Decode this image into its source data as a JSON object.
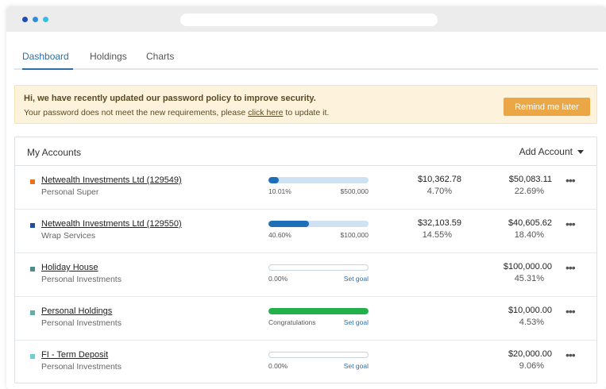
{
  "window": {
    "dot_colors": [
      "#1a4fb5",
      "#2f8ddb",
      "#33bfe0"
    ]
  },
  "tabs": [
    {
      "label": "Dashboard",
      "active": true
    },
    {
      "label": "Holdings",
      "active": false
    },
    {
      "label": "Charts",
      "active": false
    }
  ],
  "alert": {
    "title": "Hi, we have recently updated our password policy to improve security.",
    "message_before": "Your password does not meet the new requirements, please ",
    "link_text": "click here",
    "message_after": " to update it.",
    "button_label": "Remind me later"
  },
  "accounts": {
    "title": "My Accounts",
    "add_label": "Add Account",
    "rows": [
      {
        "name": "Netwealth Investments Ltd (129549)",
        "sub": "Personal Super",
        "swatch": "#e8731c",
        "progress": 0.1001,
        "bar_color": "#1f6fb8",
        "bar_empty": false,
        "bar_left": "10.01%",
        "bar_right": "$500,000",
        "bar_right_is_goal": false,
        "mid_value": "$10,362.78",
        "mid_pct": "4.70%",
        "right_value": "$50,083.11",
        "right_pct": "22.69%"
      },
      {
        "name": "Netwealth Investments Ltd (129550)",
        "sub": "Wrap Services",
        "swatch": "#1f4f9a",
        "progress": 0.406,
        "bar_color": "#1f6fb8",
        "bar_empty": false,
        "bar_left": "40.60%",
        "bar_right": "$100,000",
        "bar_right_is_goal": false,
        "mid_value": "$32,103.59",
        "mid_pct": "14.55%",
        "right_value": "$40,605.62",
        "right_pct": "18.40%"
      },
      {
        "name": "Holiday House",
        "sub": "Personal Investments",
        "swatch": "#4c8c8a",
        "progress": 0,
        "bar_color": "#1f6fb8",
        "bar_empty": true,
        "bar_left": "0.00%",
        "bar_right": "Set goal",
        "bar_right_is_goal": true,
        "mid_value": "",
        "mid_pct": "",
        "right_value": "$100,000.00",
        "right_pct": "45.31%"
      },
      {
        "name": "Personal Holdings",
        "sub": "Personal Investments",
        "swatch": "#5fb0a8",
        "progress": 1,
        "bar_color": "#22b04a",
        "bar_empty": false,
        "bar_left": "Congratulations",
        "bar_right": "Set goal",
        "bar_right_is_goal": true,
        "mid_value": "",
        "mid_pct": "",
        "right_value": "$10,000.00",
        "right_pct": "4.53%"
      },
      {
        "name": "FI - Term Deposit",
        "sub": "Personal Investments",
        "swatch": "#6cd0d2",
        "progress": 0,
        "bar_color": "#1f6fb8",
        "bar_empty": true,
        "bar_left": "0.00%",
        "bar_right": "Set goal",
        "bar_right_is_goal": true,
        "mid_value": "",
        "mid_pct": "",
        "right_value": "$20,000.00",
        "right_pct": "9.06%"
      }
    ]
  }
}
